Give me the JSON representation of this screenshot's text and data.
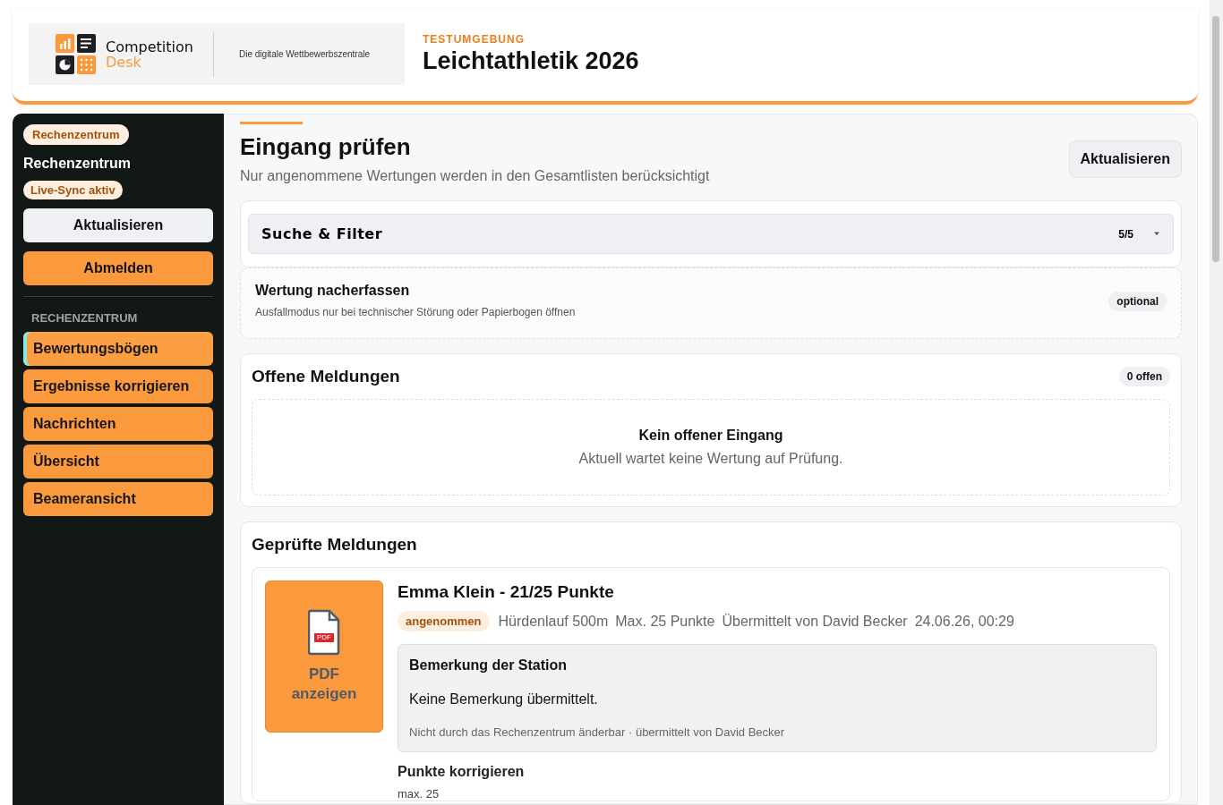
{
  "header": {
    "logo": {
      "line1": "Competition",
      "line2": "Desk"
    },
    "tagline": "Die digitale Wettbewerbszentrale",
    "environment": "TESTUMGEBUNG",
    "title": "Leichtathletik 2026"
  },
  "sidebar": {
    "role_badge": "Rechenzentrum",
    "user": "Rechenzentrum",
    "sync_badge": "Live-Sync aktiv",
    "refresh_button": "Aktualisieren",
    "logout_button": "Abmelden",
    "section": "RECHENZENTRUM",
    "items": [
      {
        "label": "Bewertungsbögen",
        "selected": true
      },
      {
        "label": "Ergebnisse korrigieren",
        "selected": false
      },
      {
        "label": "Nachrichten",
        "selected": false
      },
      {
        "label": "Übersicht",
        "selected": false
      },
      {
        "label": "Beameransicht",
        "selected": false
      }
    ]
  },
  "page": {
    "title": "Eingang prüfen",
    "subtitle": "Nur angenommene Wertungen werden in den Gesamtlisten berücksichtigt",
    "refresh_button": "Aktualisieren"
  },
  "filter": {
    "label": "Suche & Filter",
    "count": "5/5",
    "expanded": false
  },
  "manual_entry": {
    "title": "Wertung nacherfassen",
    "description": "Ausfallmodus nur bei technischer Störung oder Papierbogen öffnen",
    "badge": "optional"
  },
  "open_reports": {
    "title": "Offene Meldungen",
    "count": "0 offen",
    "empty_title": "Kein offener Eingang",
    "empty_text": "Aktuell wartet keine Wertung auf Prüfung."
  },
  "checked_reports": {
    "title": "Geprüfte Meldungen",
    "items": [
      {
        "pdf_label": "PDF",
        "pdf_button": "PDF anzeigen",
        "title": "Emma Klein - 21/25 Punkte",
        "status": "angenommen",
        "meta": [
          "Hürdenlauf 500m",
          "Max. 25 Punkte",
          "Übermittelt von David Becker",
          "24.06.26, 00:29"
        ],
        "remark_title": "Bemerkung der Station",
        "remark": "Keine Bemerkung übermittelt.",
        "remark_note": "Nicht durch das Rechenzentrum änderbar · übermittelt von David Becker",
        "correct_label": "Punkte korrigieren",
        "max_label": "max. 25"
      }
    ]
  }
}
